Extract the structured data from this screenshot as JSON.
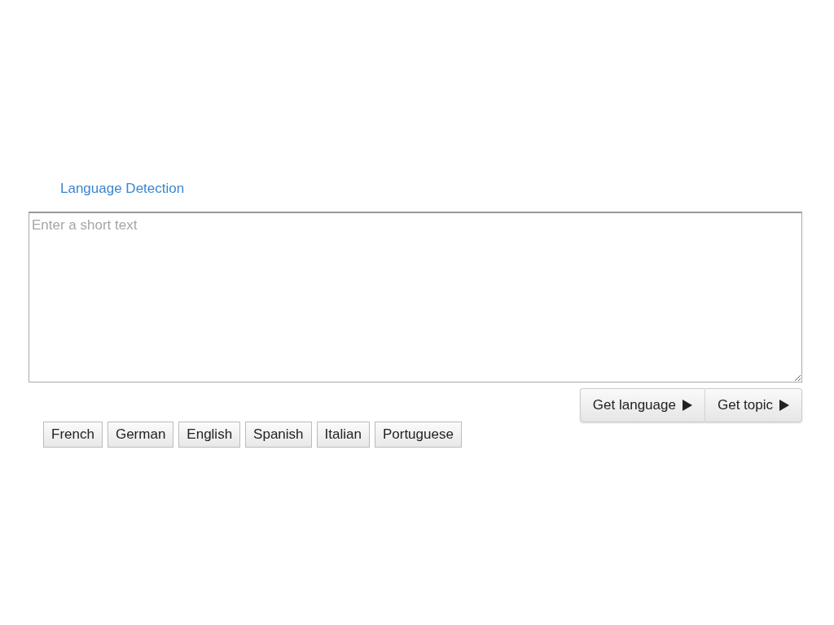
{
  "title": "Language Detection",
  "input": {
    "placeholder": "Enter a short text"
  },
  "actions": [
    {
      "label": "Get language"
    },
    {
      "label": "Get topic"
    }
  ],
  "languages": [
    "French",
    "German",
    "English",
    "Spanish",
    "Italian",
    "Portuguese"
  ]
}
